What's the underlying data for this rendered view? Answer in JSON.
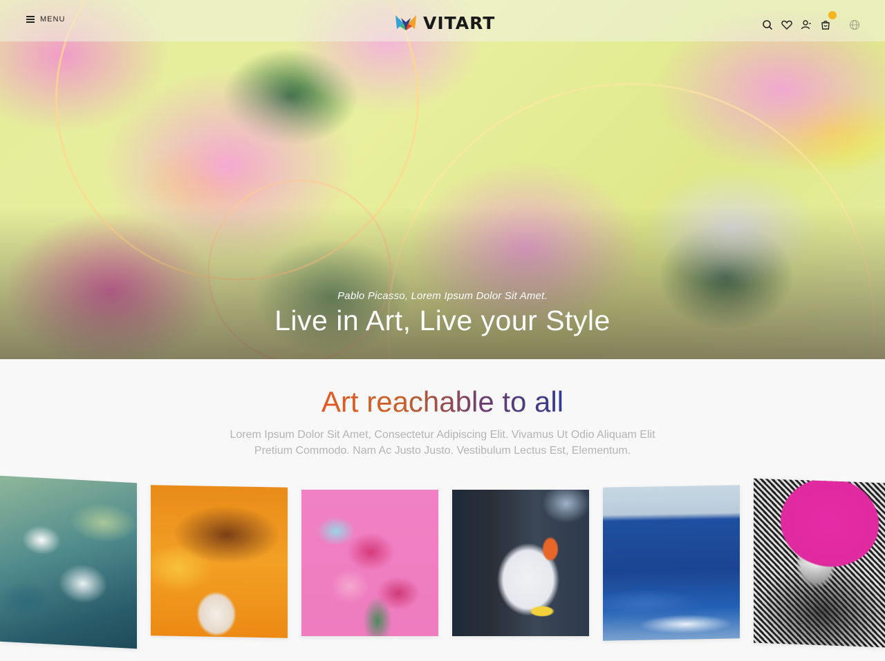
{
  "header": {
    "menu_label": "MENU",
    "logo_text": "VITART",
    "icons": [
      "search-icon",
      "heart-icon",
      "user-icon",
      "cart-icon",
      "globe-icon"
    ],
    "cart_badge_color": "#f7b51d"
  },
  "hero": {
    "subtitle": "Pablo Picasso, Lorem Ipsum Dolor Sit Amet.",
    "headline": "Live in Art, Live your Style"
  },
  "section": {
    "title": "Art reachable to all",
    "description": "Lorem Ipsum Dolor Sit Amet, Consectetur Adipiscing Elit. Vivamus Ut Odio Aliquam Elit Pretium Commodo. Nam Ac Justo Justo. Vestibulum Lectus Est, Elementum.",
    "title_gradient": [
      "#e8581f",
      "#c76128",
      "#6d3d6f",
      "#2e3a93"
    ]
  },
  "gallery": {
    "items": [
      {
        "name": "white-flowers-painting"
      },
      {
        "name": "orange-vase-painting"
      },
      {
        "name": "pink-lily-painting"
      },
      {
        "name": "abstract-painting"
      },
      {
        "name": "ocean-painting"
      },
      {
        "name": "portrait-headdress-painting"
      }
    ]
  }
}
